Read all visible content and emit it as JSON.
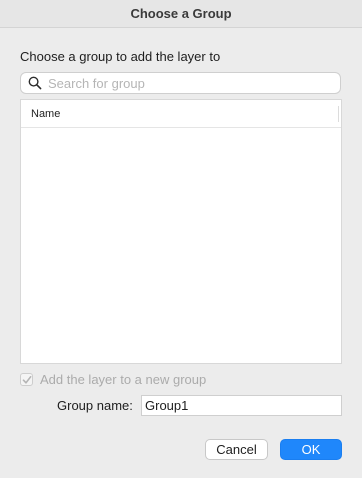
{
  "dialog": {
    "title": "Choose a Group",
    "prompt": "Choose a group to add the layer to"
  },
  "search": {
    "placeholder": "Search for group",
    "value": "",
    "icon": "search-icon"
  },
  "group_list": {
    "columns": [
      "Name"
    ],
    "rows": []
  },
  "new_group_option": {
    "label": "Add the layer to a new group",
    "checked": true,
    "enabled": false
  },
  "group_name": {
    "label": "Group name:",
    "value": "Group1"
  },
  "buttons": {
    "cancel_label": "Cancel",
    "ok_label": "OK"
  },
  "colors": {
    "accent": "#1f87fb",
    "background": "#ececec"
  }
}
